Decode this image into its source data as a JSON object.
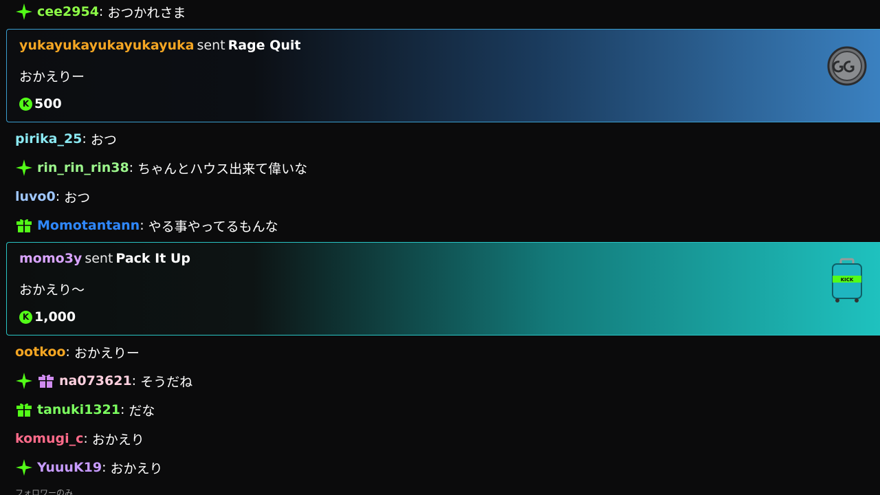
{
  "colors": {
    "green_badge": "#53fc18",
    "gift_blue_border": "#3a9fd0",
    "gift_teal_border": "#29c6c6"
  },
  "messages_top": [
    {
      "user": "cee2954",
      "user_color": "#8dfc47",
      "text": "おつかれさま",
      "badges": [
        "sparkle-icon"
      ]
    }
  ],
  "gift1": {
    "user": "yukayukayukayukayuka",
    "user_color": "#f5a623",
    "sent": "sent",
    "item": "Rage Quit",
    "message": "おかえりー",
    "amount": "500",
    "coin": "K",
    "art_icon": "gg-coin-icon"
  },
  "messages_mid": [
    {
      "user": "pirika_25",
      "user_color": "#8be9f2",
      "text": "おつ",
      "badges": []
    },
    {
      "user": "rin_rin_rin38",
      "user_color": "#9cf58c",
      "text": "ちゃんとハウス出来て偉いな",
      "badges": [
        "sparkle-icon"
      ]
    },
    {
      "user": "luvo0",
      "user_color": "#9fc7ff",
      "text": "おつ",
      "badges": []
    },
    {
      "user": "Momotantann",
      "user_color": "#2f88ff",
      "text": "やる事やってるもんな",
      "badges": [
        "gift-box-icon"
      ]
    }
  ],
  "gift2": {
    "user": "momo3y",
    "user_color": "#d9a4ff",
    "sent": "sent",
    "item": "Pack It Up",
    "message": "おかえり〜",
    "amount": "1,000",
    "coin": "K",
    "art_icon": "suitcase-icon",
    "art_text": "KICK"
  },
  "messages_bottom": [
    {
      "user": "ootkoo",
      "user_color": "#f5a623",
      "text": "おかえりー",
      "badges": []
    },
    {
      "user": "na073621",
      "user_color": "#ffd0df",
      "text": "そうだね",
      "badges": [
        "sparkle-icon",
        "gift-box-pink-icon"
      ]
    },
    {
      "user": "tanuki1321",
      "user_color": "#7cff5f",
      "text": "だな",
      "badges": [
        "gift-box-icon"
      ]
    },
    {
      "user": "komugi_c",
      "user_color": "#ff6b8a",
      "text": "おかえり",
      "badges": []
    },
    {
      "user": "YuuuK19",
      "user_color": "#c79bff",
      "text": "おかえり",
      "badges": [
        "sparkle-icon"
      ]
    }
  ],
  "footer_note": "フォロワーのみ"
}
